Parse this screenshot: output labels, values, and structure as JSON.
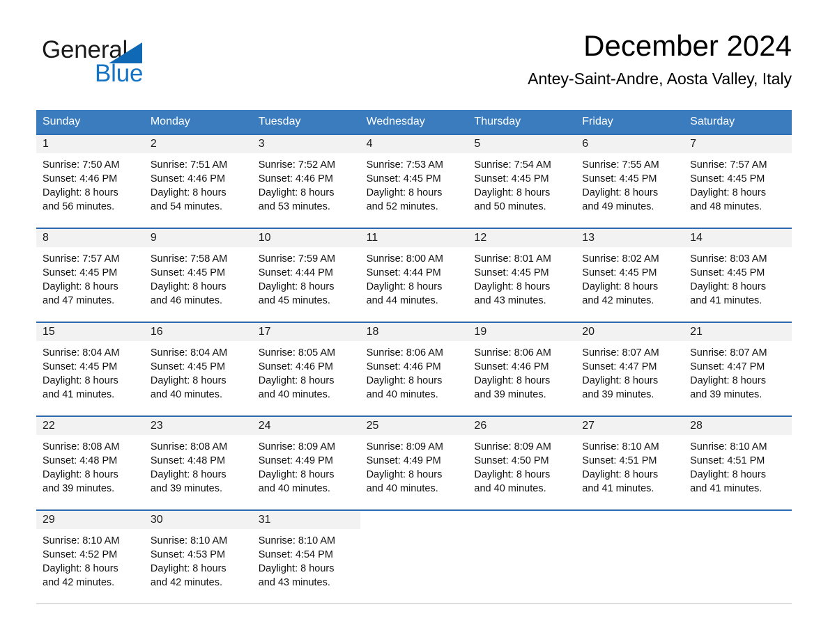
{
  "brand": {
    "name_part1": "General",
    "name_part2": "Blue",
    "triangle_color": "#1069b4",
    "blue_text_color": "#1574c4"
  },
  "header": {
    "month_title": "December 2024",
    "location": "Antey-Saint-Andre, Aosta Valley, Italy"
  },
  "theme": {
    "header_row_bg": "#3a7cbe",
    "week_border": "#2f6eb5",
    "daynum_band_bg": "#f2f2f2",
    "page_bg": "#ffffff"
  },
  "weekday_headers": [
    "Sunday",
    "Monday",
    "Tuesday",
    "Wednesday",
    "Thursday",
    "Friday",
    "Saturday"
  ],
  "weeks": [
    {
      "days": [
        {
          "day": "1",
          "lines": [
            "Sunrise: 7:50 AM",
            "Sunset: 4:46 PM",
            "Daylight: 8 hours",
            "and 56 minutes."
          ]
        },
        {
          "day": "2",
          "lines": [
            "Sunrise: 7:51 AM",
            "Sunset: 4:46 PM",
            "Daylight: 8 hours",
            "and 54 minutes."
          ]
        },
        {
          "day": "3",
          "lines": [
            "Sunrise: 7:52 AM",
            "Sunset: 4:46 PM",
            "Daylight: 8 hours",
            "and 53 minutes."
          ]
        },
        {
          "day": "4",
          "lines": [
            "Sunrise: 7:53 AM",
            "Sunset: 4:45 PM",
            "Daylight: 8 hours",
            "and 52 minutes."
          ]
        },
        {
          "day": "5",
          "lines": [
            "Sunrise: 7:54 AM",
            "Sunset: 4:45 PM",
            "Daylight: 8 hours",
            "and 50 minutes."
          ]
        },
        {
          "day": "6",
          "lines": [
            "Sunrise: 7:55 AM",
            "Sunset: 4:45 PM",
            "Daylight: 8 hours",
            "and 49 minutes."
          ]
        },
        {
          "day": "7",
          "lines": [
            "Sunrise: 7:57 AM",
            "Sunset: 4:45 PM",
            "Daylight: 8 hours",
            "and 48 minutes."
          ]
        }
      ]
    },
    {
      "days": [
        {
          "day": "8",
          "lines": [
            "Sunrise: 7:57 AM",
            "Sunset: 4:45 PM",
            "Daylight: 8 hours",
            "and 47 minutes."
          ]
        },
        {
          "day": "9",
          "lines": [
            "Sunrise: 7:58 AM",
            "Sunset: 4:45 PM",
            "Daylight: 8 hours",
            "and 46 minutes."
          ]
        },
        {
          "day": "10",
          "lines": [
            "Sunrise: 7:59 AM",
            "Sunset: 4:44 PM",
            "Daylight: 8 hours",
            "and 45 minutes."
          ]
        },
        {
          "day": "11",
          "lines": [
            "Sunrise: 8:00 AM",
            "Sunset: 4:44 PM",
            "Daylight: 8 hours",
            "and 44 minutes."
          ]
        },
        {
          "day": "12",
          "lines": [
            "Sunrise: 8:01 AM",
            "Sunset: 4:45 PM",
            "Daylight: 8 hours",
            "and 43 minutes."
          ]
        },
        {
          "day": "13",
          "lines": [
            "Sunrise: 8:02 AM",
            "Sunset: 4:45 PM",
            "Daylight: 8 hours",
            "and 42 minutes."
          ]
        },
        {
          "day": "14",
          "lines": [
            "Sunrise: 8:03 AM",
            "Sunset: 4:45 PM",
            "Daylight: 8 hours",
            "and 41 minutes."
          ]
        }
      ]
    },
    {
      "days": [
        {
          "day": "15",
          "lines": [
            "Sunrise: 8:04 AM",
            "Sunset: 4:45 PM",
            "Daylight: 8 hours",
            "and 41 minutes."
          ]
        },
        {
          "day": "16",
          "lines": [
            "Sunrise: 8:04 AM",
            "Sunset: 4:45 PM",
            "Daylight: 8 hours",
            "and 40 minutes."
          ]
        },
        {
          "day": "17",
          "lines": [
            "Sunrise: 8:05 AM",
            "Sunset: 4:46 PM",
            "Daylight: 8 hours",
            "and 40 minutes."
          ]
        },
        {
          "day": "18",
          "lines": [
            "Sunrise: 8:06 AM",
            "Sunset: 4:46 PM",
            "Daylight: 8 hours",
            "and 40 minutes."
          ]
        },
        {
          "day": "19",
          "lines": [
            "Sunrise: 8:06 AM",
            "Sunset: 4:46 PM",
            "Daylight: 8 hours",
            "and 39 minutes."
          ]
        },
        {
          "day": "20",
          "lines": [
            "Sunrise: 8:07 AM",
            "Sunset: 4:47 PM",
            "Daylight: 8 hours",
            "and 39 minutes."
          ]
        },
        {
          "day": "21",
          "lines": [
            "Sunrise: 8:07 AM",
            "Sunset: 4:47 PM",
            "Daylight: 8 hours",
            "and 39 minutes."
          ]
        }
      ]
    },
    {
      "days": [
        {
          "day": "22",
          "lines": [
            "Sunrise: 8:08 AM",
            "Sunset: 4:48 PM",
            "Daylight: 8 hours",
            "and 39 minutes."
          ]
        },
        {
          "day": "23",
          "lines": [
            "Sunrise: 8:08 AM",
            "Sunset: 4:48 PM",
            "Daylight: 8 hours",
            "and 39 minutes."
          ]
        },
        {
          "day": "24",
          "lines": [
            "Sunrise: 8:09 AM",
            "Sunset: 4:49 PM",
            "Daylight: 8 hours",
            "and 40 minutes."
          ]
        },
        {
          "day": "25",
          "lines": [
            "Sunrise: 8:09 AM",
            "Sunset: 4:49 PM",
            "Daylight: 8 hours",
            "and 40 minutes."
          ]
        },
        {
          "day": "26",
          "lines": [
            "Sunrise: 8:09 AM",
            "Sunset: 4:50 PM",
            "Daylight: 8 hours",
            "and 40 minutes."
          ]
        },
        {
          "day": "27",
          "lines": [
            "Sunrise: 8:10 AM",
            "Sunset: 4:51 PM",
            "Daylight: 8 hours",
            "and 41 minutes."
          ]
        },
        {
          "day": "28",
          "lines": [
            "Sunrise: 8:10 AM",
            "Sunset: 4:51 PM",
            "Daylight: 8 hours",
            "and 41 minutes."
          ]
        }
      ]
    },
    {
      "days": [
        {
          "day": "29",
          "lines": [
            "Sunrise: 8:10 AM",
            "Sunset: 4:52 PM",
            "Daylight: 8 hours",
            "and 42 minutes."
          ]
        },
        {
          "day": "30",
          "lines": [
            "Sunrise: 8:10 AM",
            "Sunset: 4:53 PM",
            "Daylight: 8 hours",
            "and 42 minutes."
          ]
        },
        {
          "day": "31",
          "lines": [
            "Sunrise: 8:10 AM",
            "Sunset: 4:54 PM",
            "Daylight: 8 hours",
            "and 43 minutes."
          ]
        },
        {
          "day": "",
          "lines": []
        },
        {
          "day": "",
          "lines": []
        },
        {
          "day": "",
          "lines": []
        },
        {
          "day": "",
          "lines": []
        }
      ]
    }
  ]
}
